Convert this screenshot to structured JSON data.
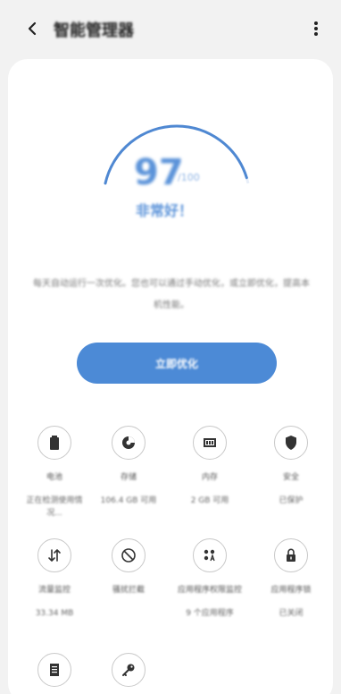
{
  "header": {
    "title": "智能管理器",
    "back_icon": "chevron-left-icon",
    "more_icon": "more-vert-icon"
  },
  "score": {
    "value": "97",
    "unit": "/100",
    "status": "非常好！",
    "fraction": 0.97
  },
  "description": "每天自动运行一次优化。您也可以通过手动优化，或立即优化，提高本机性能。",
  "optimize_button": "立即优化",
  "tiles": [
    {
      "icon": "battery-icon",
      "label": "电池",
      "value": "正在检测使用情况..."
    },
    {
      "icon": "storage-icon",
      "label": "存储",
      "value": "106.4 GB 可用"
    },
    {
      "icon": "memory-icon",
      "label": "内存",
      "value": "2 GB 可用"
    },
    {
      "icon": "shield-icon",
      "label": "安全",
      "value": "已保护"
    },
    {
      "icon": "data-saver-icon",
      "label": "流量监控",
      "value": "33.34 MB"
    },
    {
      "icon": "block-icon",
      "label": "骚扰拦截",
      "value": ""
    },
    {
      "icon": "apps-icon",
      "label": "应用程序权限监控",
      "value": "9 个应用程序"
    },
    {
      "icon": "lock-icon",
      "label": "应用程序锁",
      "value": "已关闭"
    },
    {
      "icon": "notes-icon",
      "label": "",
      "value": ""
    },
    {
      "icon": "key-icon",
      "label": "",
      "value": ""
    }
  ]
}
